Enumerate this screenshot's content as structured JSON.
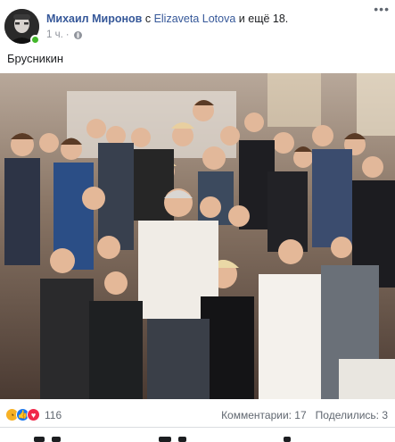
{
  "post": {
    "author": "Михаил Миронов",
    "with_word": "с",
    "tagged": "Elizaveta Lotova",
    "and_more": "и ещё 18.",
    "time": "1 ч.",
    "separator": "·",
    "more_icon": "more-dots-icon",
    "text": "Брусникин"
  },
  "footer": {
    "reaction_count": "116",
    "comments": "Комментарии: 17",
    "shares": "Поделились: 3",
    "reaction_icons": [
      "sad-icon",
      "like-icon",
      "love-icon"
    ]
  },
  "colors": {
    "link": "#365899",
    "online": "#42b72a",
    "like": "#1877f2",
    "love": "#f0284a",
    "sad": "#f7b125"
  }
}
